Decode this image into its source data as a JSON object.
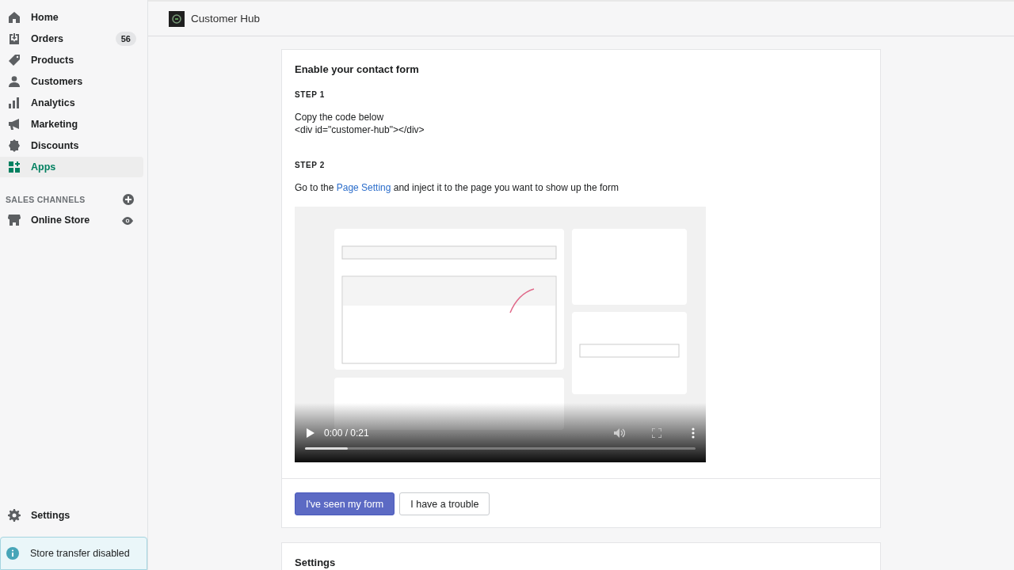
{
  "sidebar": {
    "items": [
      {
        "label": "Home",
        "kind": "home",
        "selected": false
      },
      {
        "label": "Orders",
        "kind": "orders",
        "selected": false,
        "badge": "56"
      },
      {
        "label": "Products",
        "kind": "tag",
        "selected": false
      },
      {
        "label": "Customers",
        "kind": "person",
        "selected": false
      },
      {
        "label": "Analytics",
        "kind": "bars",
        "selected": false
      },
      {
        "label": "Marketing",
        "kind": "megaphone",
        "selected": false
      },
      {
        "label": "Discounts",
        "kind": "discount",
        "selected": false
      },
      {
        "label": "Apps",
        "kind": "apps",
        "selected": true
      }
    ],
    "sales_channels": {
      "heading": "SALES CHANNELS",
      "items": [
        {
          "label": "Online Store",
          "kind": "store"
        }
      ]
    },
    "settings": {
      "label": "Settings"
    },
    "notice": {
      "text": "Store transfer disabled"
    }
  },
  "top_bar": {
    "title": "Customer Hub"
  },
  "card": {
    "title": "Enable your contact form",
    "step1": {
      "heading": "STEP 1",
      "lines": [
        "Copy the code below",
        "<div id=\"customer-hub\"></div>"
      ]
    },
    "step2": {
      "heading": "STEP 2",
      "before": "Go to the ",
      "link": "Page Setting",
      "after": " and inject it to the page you want to show up the form"
    },
    "video": {
      "kind": "picture",
      "time": "0:00 / 0:21",
      "level": 0.11
    },
    "buttons": [
      {
        "label": "I've seen my form",
        "kind": "primary"
      },
      {
        "label": "I have a trouble",
        "kind": "secondary"
      }
    ]
  },
  "settings_card": {
    "title": "Settings"
  }
}
